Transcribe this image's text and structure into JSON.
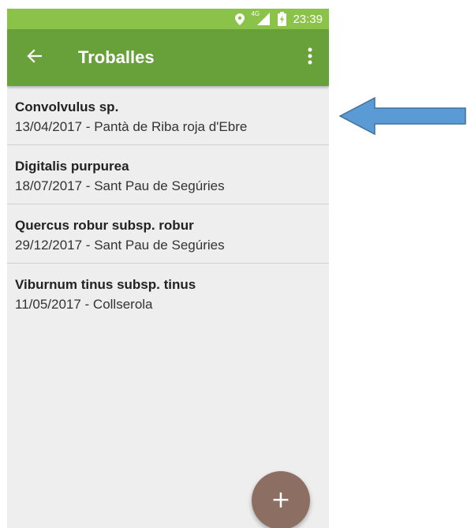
{
  "status_bar": {
    "time": "23:39",
    "network_label": "4G",
    "icons": [
      "location-icon",
      "signal-icon",
      "battery-icon"
    ],
    "color": "#8bc34a"
  },
  "toolbar": {
    "title": "Troballes",
    "back_icon": "arrow-back-icon",
    "menu_icon": "more-vert-icon",
    "color": "#68a13a"
  },
  "findings": [
    {
      "name": "Convolvulus sp.",
      "meta": "13/04/2017 - Pantà de Riba roja d'Ebre"
    },
    {
      "name": "Digitalis purpurea",
      "meta": "18/07/2017 - Sant Pau de Segúries"
    },
    {
      "name": "Quercus robur subsp. robur",
      "meta": "29/12/2017 - Sant Pau de Segúries"
    },
    {
      "name": "Viburnum tinus subsp. tinus",
      "meta": "11/05/2017 - Collserola"
    }
  ],
  "fab": {
    "label": "+",
    "icon": "add-icon",
    "color": "#8d6e63"
  },
  "annotation": {
    "icon": "arrow-left-icon",
    "color": "#5b9bd5"
  }
}
